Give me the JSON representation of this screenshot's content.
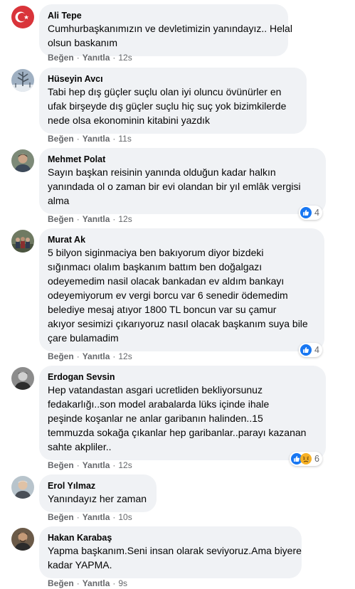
{
  "colors": {
    "bubble_bg": "#f0f2f5",
    "meta_text": "#65676b",
    "like_blue": "#1877f2",
    "sad_yellow": "#f7b125"
  },
  "comments": [
    {
      "author": "Ali Tepe",
      "avatar_icon": "turkish-flag-avatar",
      "lines": [
        "Cumhurbaşkanımızın ve devletimizin yanındayız.. Helal",
        "olsun baskanım"
      ],
      "like": "Beğen",
      "reply": "Yanıtla",
      "time": "12s"
    },
    {
      "author": "Hüseyin Avcı",
      "avatar_icon": "snowy-tree-avatar",
      "lines": [
        "Tabi hep dış güçler suçlu olan iyi oluncu övünürler en",
        "ufak birşeyde dış güçler suçlu hiç suç yok bizimkilerde",
        "nede olsa ekonominin kitabini yazdık"
      ],
      "like": "Beğen",
      "reply": "Yanıtla",
      "time": "11s"
    },
    {
      "author": "Mehmet Polat",
      "avatar_icon": "man-portrait-avatar",
      "lines": [
        "Sayın başkan reisinin yanında olduğun kadar halkın",
        "yanındada ol o zaman bir evi olandan bir yıl emlâk vergisi",
        "alma"
      ],
      "like": "Beğen",
      "reply": "Yanıtla",
      "time": "12s",
      "reactions": {
        "icons": [
          "like-reaction-icon"
        ],
        "count": "4"
      }
    },
    {
      "author": "Murat Ak",
      "avatar_icon": "group-photo-avatar",
      "lines": [
        "5 bilyon siginmaciya ben bakıyorum diyor bizdeki",
        "sığınmacı olalım başkanım battım ben doğalgazı",
        "odeyemedim nasil olacak bankadan ev aldım bankayı",
        "odeyemiyorum ev vergi borcu var 6 senedir ödemedim",
        "belediye mesaj atıyor 1800 TL boncun var su çamur",
        "akıyor sesimizi çıkarıyoruz nasıl olacak başkanım suya bile",
        "çare bulamadim"
      ],
      "like": "Beğen",
      "reply": "Yanıtla",
      "time": "12s",
      "reactions": {
        "icons": [
          "like-reaction-icon"
        ],
        "count": "4"
      }
    },
    {
      "author": "Erdogan Sevsin",
      "avatar_icon": "man-portrait-avatar",
      "lines": [
        "Hep vatandastan asgari ucretliden bekliyorsunuz",
        "fedakarlığı..son model arabalarda lüks içinde ihale",
        "peşinde koşanlar ne anlar garibanın halinden..15",
        "temmuzda sokağa çıkanlar hep garibanlar..parayı kazanan",
        "sahte akpliler.."
      ],
      "like": "Beğen",
      "reply": "Yanıtla",
      "time": "12s",
      "reactions": {
        "icons": [
          "like-reaction-icon",
          "sad-reaction-icon"
        ],
        "count": "6"
      }
    },
    {
      "author": "Erol Yılmaz",
      "avatar_icon": "man-portrait-avatar",
      "lines": [
        "Yanındayız her zaman"
      ],
      "like": "Beğen",
      "reply": "Yanıtla",
      "time": "10s"
    },
    {
      "author": "Hakan Karabaş",
      "avatar_icon": "man-portrait-avatar",
      "lines": [
        "Yapma başkanım.Seni insan olarak seviyoruz.Ama biyere",
        "kadar YAPMA."
      ],
      "like": "Beğen",
      "reply": "Yanıtla",
      "time": "9s"
    }
  ]
}
